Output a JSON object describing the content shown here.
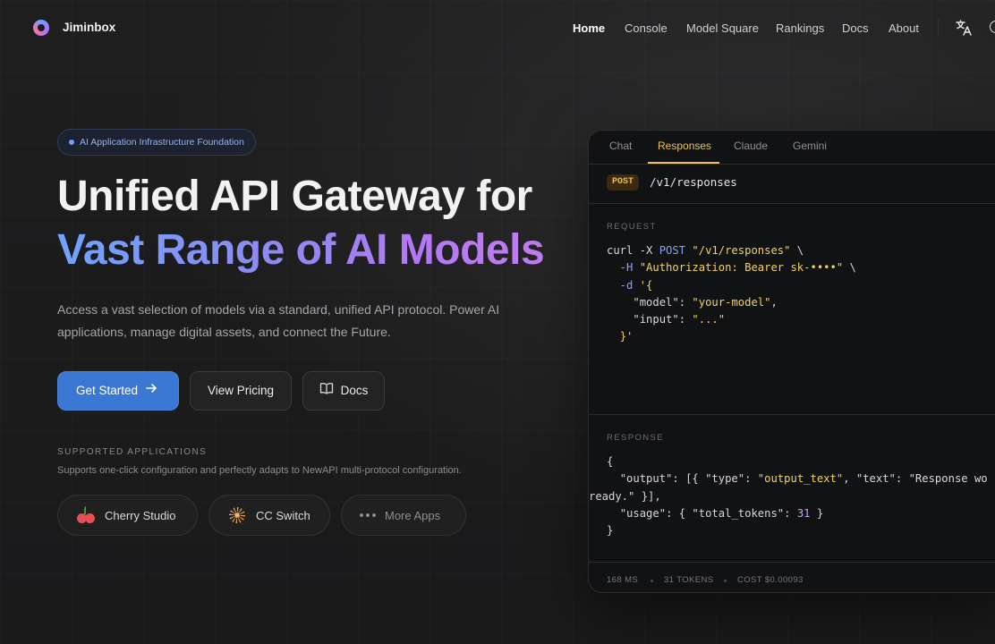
{
  "nav": {
    "brand": "Jiminbox",
    "links": [
      "Home",
      "Console",
      "Model Square",
      "Rankings",
      "Docs",
      "About"
    ],
    "active": "Home"
  },
  "hero": {
    "badge": "AI Application Infrastructure Foundation",
    "title_line1": "Unified API Gateway for",
    "title_line2": "Vast Range of AI Models",
    "lead": "Access a vast selection of models via a standard, unified API protocol. Power AI applications, manage digital assets, and connect the Future.",
    "buttons": {
      "primary": "Get Started",
      "pricing": "View Pricing",
      "docs": "Docs"
    },
    "supported_title": "SUPPORTED APPLICATIONS",
    "supported_desc": "Supports one-click configuration and perfectly adapts to NewAPI multi-protocol configuration.",
    "apps": [
      "Cherry Studio",
      "CC Switch",
      "More Apps"
    ]
  },
  "code_panel": {
    "tabs": [
      "Chat",
      "Responses",
      "Claude",
      "Gemini"
    ],
    "active_tab": "Responses",
    "method": "POST",
    "path": "/v1/responses",
    "request_label": "REQUEST",
    "request_lines": [
      "curl -X POST \"/v1/responses\" \\",
      "  -H \"Authorization: Bearer sk-••••\" \\",
      "  -d '{",
      "    \"model\": \"your-model\",",
      "    \"input\": \"...\"",
      "  }'"
    ],
    "response_label": "RESPONSE",
    "response_lines": [
      "{",
      "  \"output\": [{ \"type\": \"output_text\", \"text\": \"Response wo",
      "ready.\" }],",
      "  \"usage\": { \"total_tokens\": 31 }",
      "}"
    ],
    "footer": {
      "latency": "168 MS",
      "tokens": "31 TOKENS",
      "cost": "COST $0.00093"
    }
  },
  "colors": {
    "accent_blue": "#3a78d4",
    "accent_gold": "#f3c34a",
    "gradient_start": "#6fa3ff",
    "gradient_end": "#c07df0"
  }
}
